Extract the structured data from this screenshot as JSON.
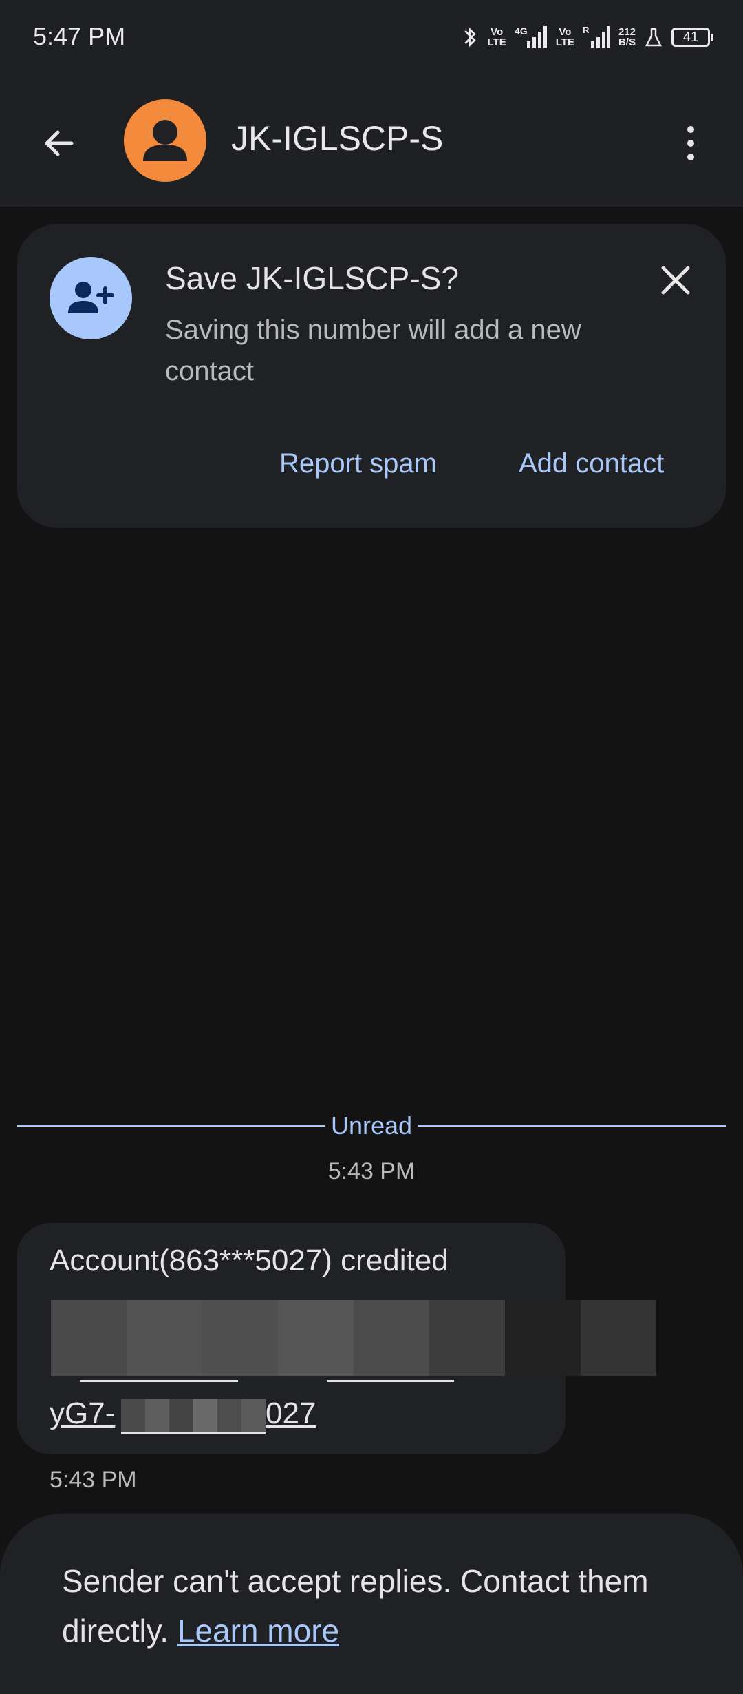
{
  "status_bar": {
    "time": "5:47 PM",
    "net_speed_top": "212",
    "net_speed_bottom": "B/S",
    "battery": "41",
    "icons": [
      "bluetooth-icon",
      "volte-icon",
      "signal-4g-icon",
      "volte-icon",
      "signal-roaming-icon",
      "lab-icon",
      "battery-icon"
    ]
  },
  "app_bar": {
    "contact_name": "JK-IGLSCP-S",
    "avatar_color": "#f48a3c"
  },
  "save_card": {
    "title": "Save JK-IGLSCP-S?",
    "subtitle": "Saving this number will add a new contact",
    "report_spam": "Report spam",
    "add_contact": "Add contact"
  },
  "conversation": {
    "divider_label": "Unread",
    "timestamp": "5:43 PM",
    "message_first_line": "Account(863***5027) credited",
    "message_link_prefix": "yG7-",
    "message_link_suffix": "027",
    "message_time": "5:43 PM"
  },
  "bottom_banner": {
    "text": "Sender can't accept replies. Contact them directly.",
    "link": "Learn more"
  },
  "colors": {
    "accent": "#a8c7fa",
    "surface": "#202124",
    "background": "#131313",
    "avatar": "#f48a3c"
  }
}
